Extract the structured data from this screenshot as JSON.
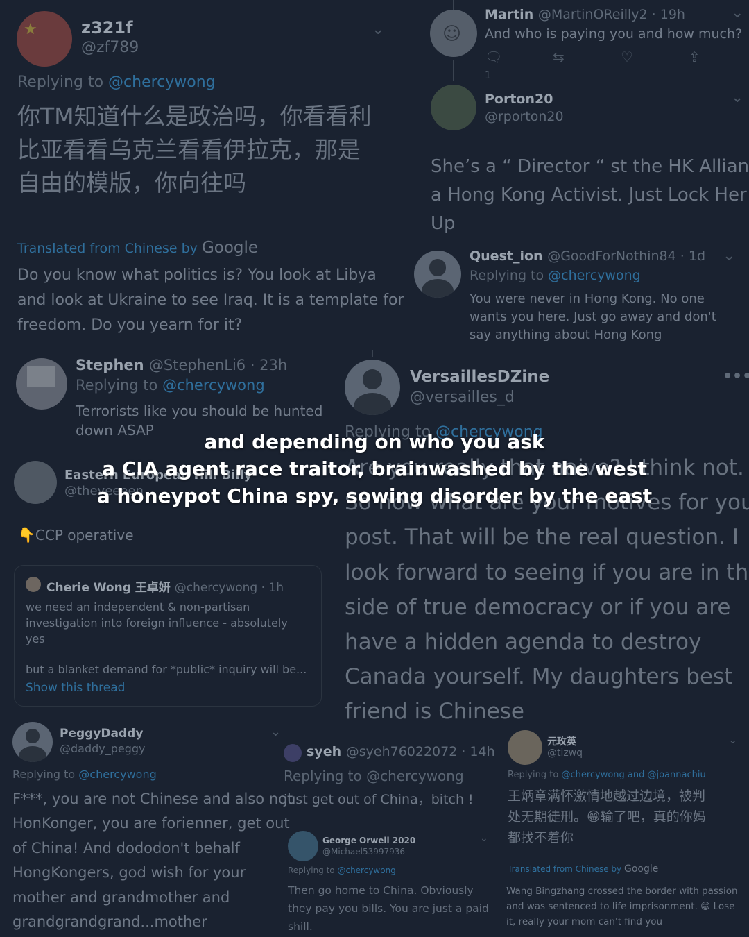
{
  "tweets": {
    "z321f": {
      "name": "z321f",
      "handle": "@zf789",
      "replying_prefix": "Replying to ",
      "replying_to": "@chercywong",
      "text_lines": [
        "你TM知道什么是政治吗，你看看利",
        "比亚看看乌克兰看看伊拉克，那是",
        "自由的模版，你向往吗"
      ],
      "translated_label": "Translated from Chinese by",
      "google": "Google",
      "translation_lines": [
        "Do you know what politics is? You look at Libya",
        "and look at Ukraine to see Iraq. It is a template for",
        "freedom. Do you yearn for it?"
      ]
    },
    "martin": {
      "name": "Martin",
      "handle": "@MartinOReilly2 · 19h",
      "text": "And who is paying you and how much?",
      "reply_count": "1"
    },
    "porton": {
      "name": "Porton20",
      "handle": "@rporton20",
      "text_lines": [
        "She’s a “ Director “ st the HK Alliance",
        "a Hong Kong Activist. Just Lock Her",
        "Up"
      ]
    },
    "quest": {
      "name": "Quest_ion",
      "handle": "@GoodForNothin84 · 1d",
      "replying_prefix": "Replying to ",
      "replying_to": "@chercywong",
      "text_lines": [
        "You were never in Hong Kong.  No one",
        "wants you here. Just go away and don't",
        "say anything about Hong Kong"
      ]
    },
    "stephen": {
      "name": "Stephen",
      "handle": "@StephenLi6 · 23h",
      "replying_prefix": "Replying to ",
      "replying_to": "@chercywong",
      "text_lines": [
        "Terrorists like you should be hunted",
        "down ASAP"
      ]
    },
    "versailles": {
      "name": "VersaillesDZine",
      "handle": "@versailles_d",
      "replying_prefix": "Replying to ",
      "replying_to": "@chercywong",
      "text_lines": [
        "Are you really that naive? I think not.",
        "So now what are your motives for your",
        "post. That will be the real question. I",
        "look forward to seeing if you are in the",
        "side of true democracy or if you are",
        "have a hidden agenda to destroy",
        "Canada yourself. My daughters best",
        "friend is Chinese"
      ]
    },
    "eastern": {
      "name": "Eastern European Hill Billy",
      "handle": "@theveeeen",
      "text": "CCP operative",
      "emoji": "👇"
    },
    "cherie": {
      "name": "Cherie Wong 王卓妍",
      "handle": "@chercywong · 1h",
      "text_lines": [
        "we need an independent & non-partisan",
        "investigation into foreign influence - absolutely",
        "yes"
      ],
      "text2": "but a blanket demand for *public* inquiry will be...",
      "show_thread": "Show this thread"
    },
    "peggy": {
      "name": "PeggyDaddy",
      "handle": "@daddy_peggy",
      "replying_prefix": "Replying to ",
      "replying_to": "@chercywong",
      "text_lines": [
        "F***, you are not Chinese and also not",
        "HonKonger, you are forienner, get out",
        "of China! And dododon't behalf",
        "HongKongers, god wish for your",
        "mother and grandmother and",
        "grandgrandgrand...mother"
      ]
    },
    "syeh": {
      "name": "syeh",
      "handle": "@syeh76022072 · 14h",
      "replying": "Replying to @chercywong",
      "text": "just get out of China，bitch !"
    },
    "orwell": {
      "name": "George Orwell 2020",
      "handle": "@Michael53997936",
      "replying_prefix": "Replying to ",
      "replying_to": "@chercywong",
      "text_lines": [
        "Then go home to China. Obviously",
        "they pay you bills.  You are just a paid",
        "shill."
      ]
    },
    "tizwq": {
      "name": "元玫英",
      "handle": "@tizwq",
      "replying_prefix": "Replying to ",
      "replying_to": "@chercywong and @joannachiu",
      "text_lines": [
        "王炳章满怀激情地越过边境，被判",
        "处无期徒刑。😁输了吧，真的你妈",
        "都找不着你"
      ],
      "translated_label": "Translated from Chinese by",
      "google": "Google",
      "translation_lines": [
        "Wang Bingzhang crossed the border with passion",
        "and was sentenced to life imprisonment. 😁 Lose",
        "it, really your mom can't find you"
      ]
    }
  },
  "overlay": {
    "line1": "and depending on who you ask",
    "line2": "a CIA agent race traitor, brainwashed by the west",
    "line3": "a honeypot China spy, sowing disorder by the east"
  },
  "colors": {
    "background": "#1a2230",
    "link": "#2f6f9c",
    "overlay_text": "#ffffff"
  }
}
